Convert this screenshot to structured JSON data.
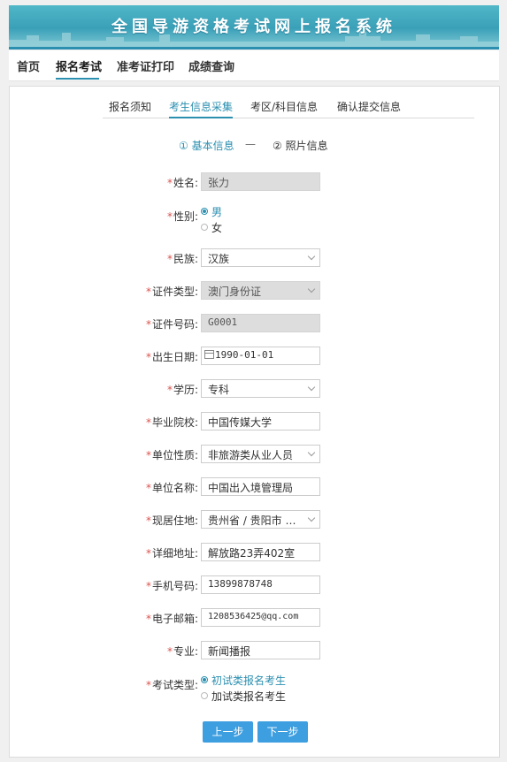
{
  "banner": {
    "title": "全国导游资格考试网上报名系统"
  },
  "topnav": {
    "items": [
      {
        "label": "首页"
      },
      {
        "label": "报名考试"
      },
      {
        "label": "准考证打印"
      },
      {
        "label": "成绩查询"
      }
    ]
  },
  "subtabs": [
    {
      "label": "报名须知"
    },
    {
      "label": "考生信息采集"
    },
    {
      "label": "考区/科目信息"
    },
    {
      "label": "确认提交信息"
    }
  ],
  "steps": {
    "step1": "① 基本信息",
    "separator": "—",
    "step2": "② 照片信息"
  },
  "form": {
    "name": {
      "label": "姓名:",
      "value": "张力"
    },
    "gender": {
      "label": "性别:",
      "options": [
        "男",
        "女"
      ],
      "selected": "男"
    },
    "ethnicity": {
      "label": "民族:",
      "value": "汉族"
    },
    "id_type": {
      "label": "证件类型:",
      "value": "澳门身份证"
    },
    "id_number": {
      "label": "证件号码:",
      "value": "G0001"
    },
    "birth_date": {
      "label": "出生日期:",
      "value": "1990-01-01"
    },
    "education": {
      "label": "学历:",
      "value": "专科"
    },
    "school": {
      "label": "毕业院校:",
      "value": "中国传媒大学"
    },
    "employer_type": {
      "label": "单位性质:",
      "value": "非旅游类从业人员"
    },
    "employer_name": {
      "label": "单位名称:",
      "value": "中国出入境管理局"
    },
    "residence": {
      "label": "现居住地:",
      "value": "贵州省 / 贵阳市 …"
    },
    "address": {
      "label": "详细地址:",
      "value": "解放路23弄402室"
    },
    "phone": {
      "label": "手机号码:",
      "value": "13899878748"
    },
    "email": {
      "label": "电子邮箱:",
      "value": "1208536425@qq.com"
    },
    "major": {
      "label": "专业:",
      "value": "新闻播报"
    },
    "exam_type": {
      "label": "考试类型:",
      "options": [
        "初试类报名考生",
        "加试类报名考生"
      ],
      "selected": "初试类报名考生"
    }
  },
  "buttons": {
    "prev": "上一步",
    "next": "下一步"
  },
  "colors": {
    "accent": "#2b8fb0",
    "button": "#3d9ee0",
    "required": "#d9534f"
  }
}
